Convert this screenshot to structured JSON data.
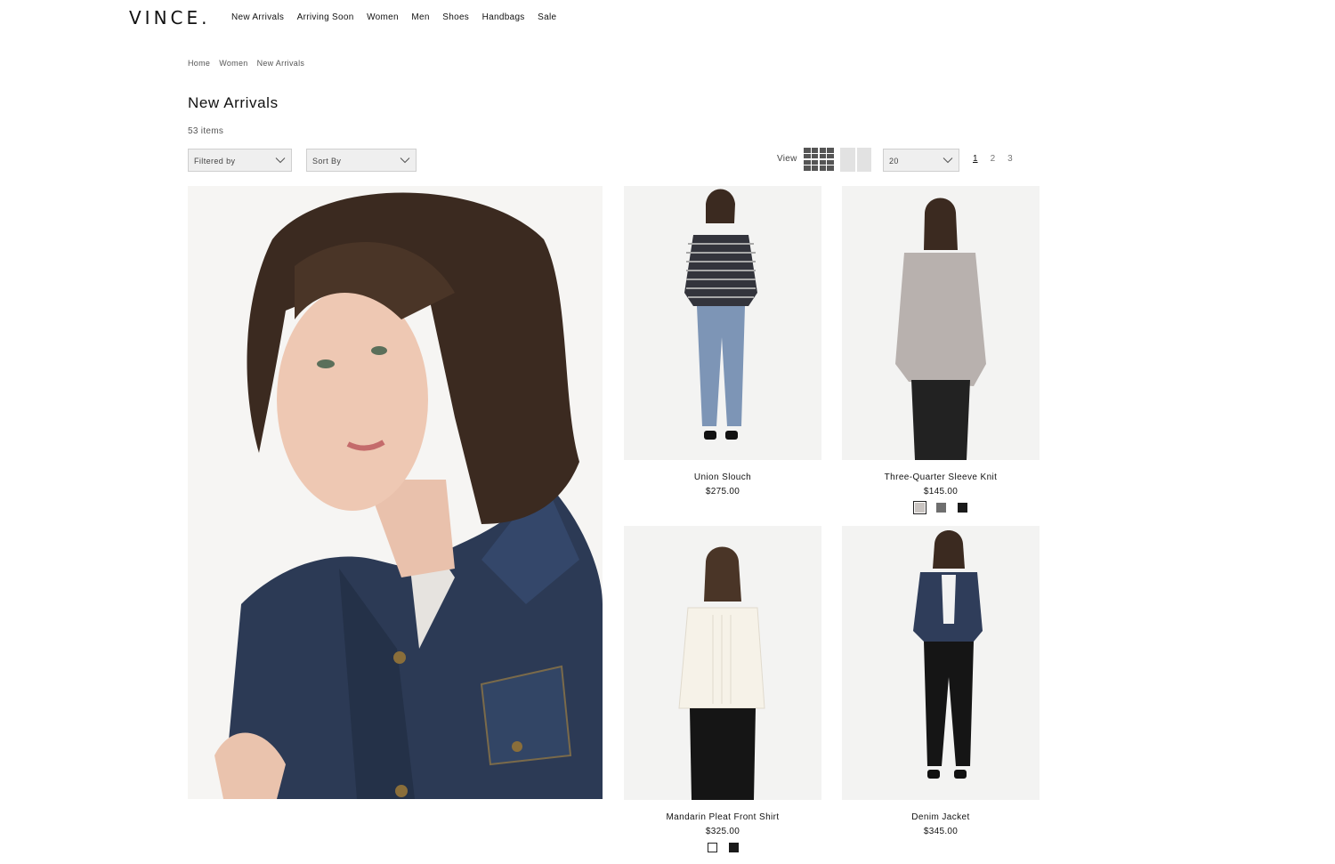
{
  "brand": {
    "logo_text": "VINCE."
  },
  "nav": {
    "items": [
      "New Arrivals",
      "Arriving Soon",
      "Women",
      "Men",
      "Shoes",
      "Handbags",
      "Sale"
    ]
  },
  "breadcrumb": [
    "Home",
    "Women",
    "New Arrivals"
  ],
  "page": {
    "title": "New Arrivals",
    "item_count": "53 items"
  },
  "toolbar": {
    "filter_label": "Filtered by",
    "sort_label": "Sort By",
    "view_label": "View",
    "per_page": "20",
    "pages": [
      "1",
      "2",
      "3"
    ],
    "current_page": "1"
  },
  "products": [
    {
      "name": "Union Slouch",
      "price": "$275.00",
      "swatches": []
    },
    {
      "name": "Three-Quarter Sleeve Knit",
      "price": "$145.00",
      "swatches": [
        "#c9c4c1",
        "#6e6e6e",
        "#1a1a1a"
      ]
    },
    {
      "name": "Mandarin Pleat Front Shirt",
      "price": "$325.00",
      "swatches": [
        "#ffffff",
        "#1a1a1a"
      ]
    },
    {
      "name": "Denim Jacket",
      "price": "$345.00",
      "swatches": []
    }
  ],
  "colors": {
    "text": "#111111",
    "select_bg": "#efefef",
    "icon_dark": "#555555",
    "icon_light": "#e2e2e2"
  }
}
